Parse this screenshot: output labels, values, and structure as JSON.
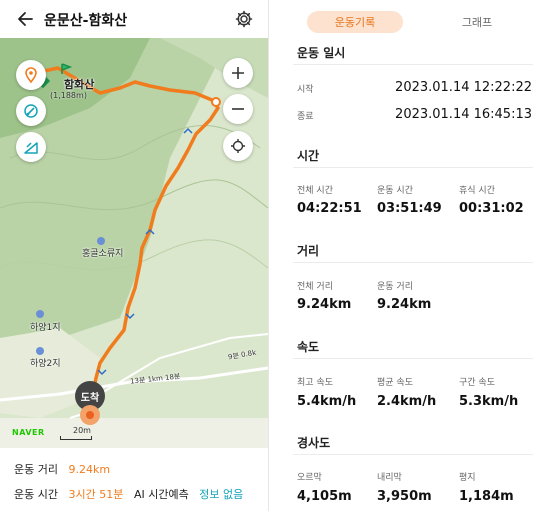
{
  "map_panel": {
    "title": "운문산-함화산",
    "peak": {
      "name": "함화산",
      "elevation": "(1,188m)"
    },
    "places": {
      "shelter": "홍골소류지",
      "hayang1": "하양1지",
      "hayang2": "하양2지"
    },
    "trail_labels": {
      "trail_a": "13분 1km 18분",
      "trail_b": "9분 0.8k"
    },
    "arrival_marker": "도착",
    "provider": "NAVER",
    "scale": "20m"
  },
  "summary": {
    "distance_label": "운동 거리",
    "distance_value": "9.24km",
    "time_label": "운동 시간",
    "time_value": "3시간 51분",
    "ai_label": "AI 시간예측",
    "ai_value": "정보 없음"
  },
  "record_panel": {
    "tabs": {
      "record": "운동기록",
      "graph": "그래프"
    },
    "datetime": {
      "title": "운동 일시",
      "start_label": "시작",
      "start_value": "2023.01.14 12:22:22",
      "end_label": "종료",
      "end_value": "2023.01.14 16:45:13"
    },
    "time": {
      "title": "시간",
      "total_label": "전체 시간",
      "total_value": "04:22:51",
      "active_label": "운동 시간",
      "active_value": "03:51:49",
      "rest_label": "휴식 시간",
      "rest_value": "00:31:02"
    },
    "distance": {
      "title": "거리",
      "total_label": "전체 거리",
      "total_value": "9.24km",
      "active_label": "운동 거리",
      "active_value": "9.24km"
    },
    "speed": {
      "title": "속도",
      "max_label": "최고 속도",
      "max_value": "5.4km/h",
      "avg_label": "평균 속도",
      "avg_value": "2.4km/h",
      "section_label": "구간 속도",
      "section_value": "5.3km/h"
    },
    "slope": {
      "title": "경사도",
      "up_label": "오르막",
      "up_value": "4,105m",
      "down_label": "내리막",
      "down_value": "3,950m",
      "flat_label": "평지",
      "flat_value": "1,184m"
    }
  },
  "colors": {
    "accent": "#f07c1e",
    "route": "#f07c1e",
    "teal": "#14a3b8",
    "tab_bg": "#fde3cf"
  }
}
